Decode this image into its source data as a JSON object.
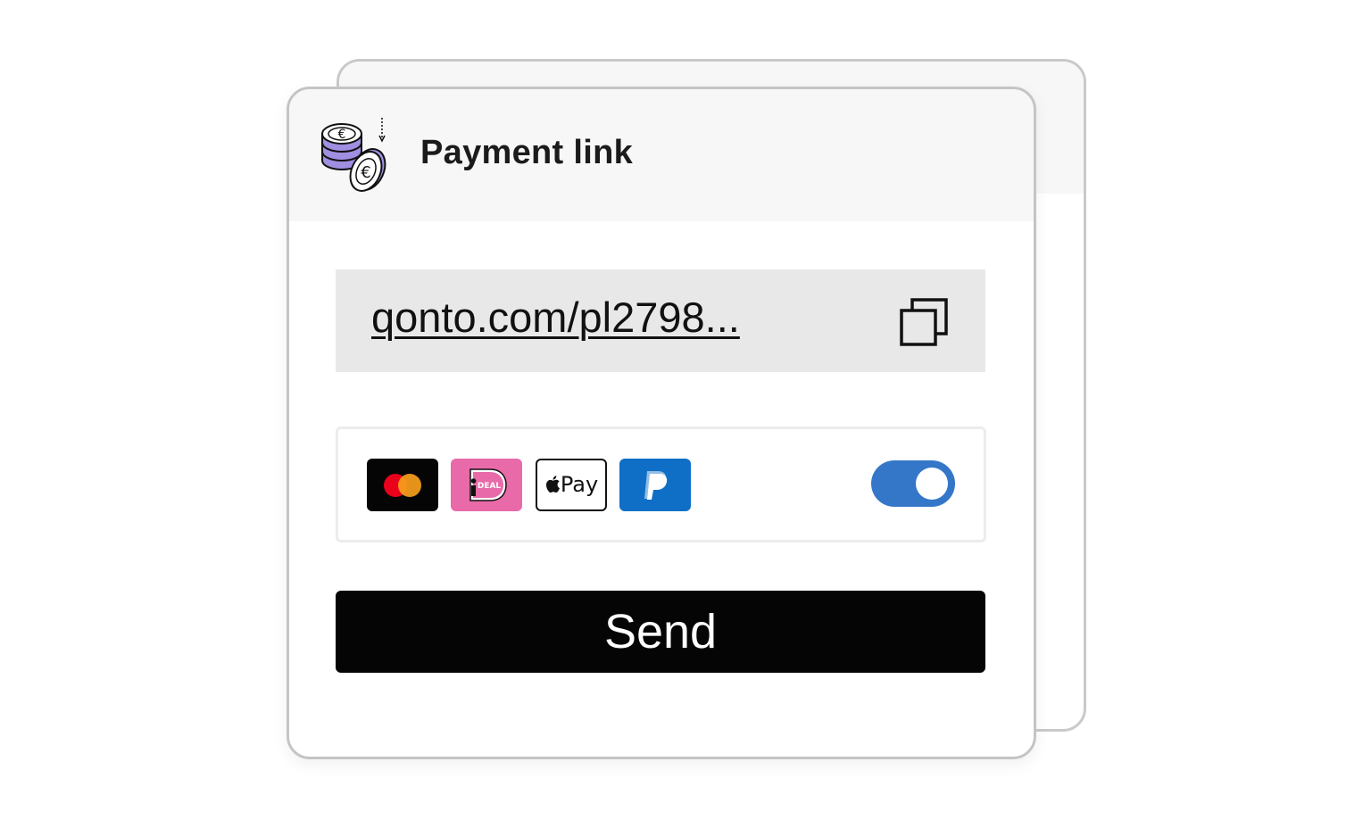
{
  "card": {
    "title": "Payment link",
    "icon": "euro-coins-icon"
  },
  "link": {
    "url_text": "qonto.com/pl2798...",
    "copy_icon": "copy-icon"
  },
  "payment_methods": {
    "items": [
      {
        "name": "mastercard",
        "icon": "mastercard-icon"
      },
      {
        "name": "ideal",
        "icon": "ideal-icon",
        "label": "DEAL"
      },
      {
        "name": "applepay",
        "icon": "apple-pay-icon",
        "label": "Pay"
      },
      {
        "name": "paypal",
        "icon": "paypal-icon"
      }
    ],
    "toggle_on": true
  },
  "actions": {
    "send_label": "Send"
  },
  "colors": {
    "header_bg": "#f7f7f7",
    "link_box_bg": "#e8e8e8",
    "toggle_on": "#3477c9",
    "button_bg": "#050505",
    "ideal_pink": "#e86aa9",
    "paypal_blue": "#0f6fc6",
    "coin_purple": "#a08ee0"
  }
}
